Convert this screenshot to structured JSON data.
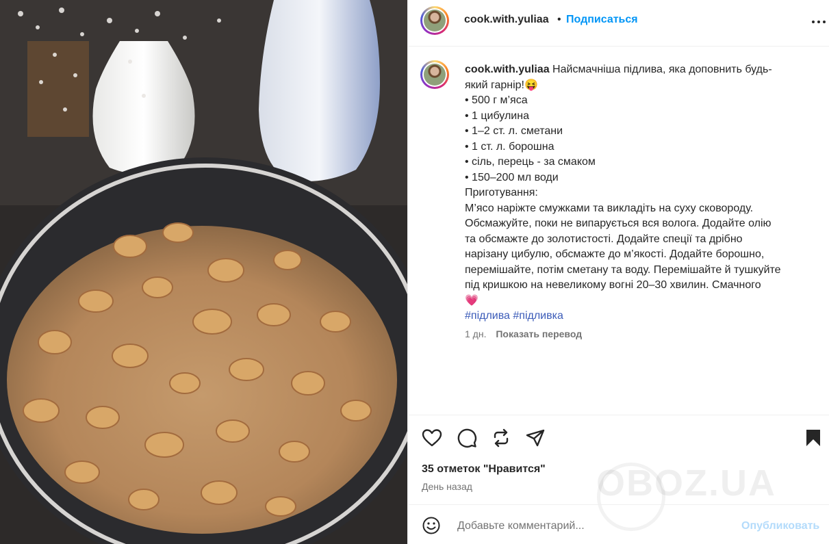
{
  "header": {
    "username": "cook.with.yuliaa",
    "separator": "•",
    "follow_label": "Подписаться",
    "more_label": "•••"
  },
  "caption": {
    "username": "cook.with.yuliaa",
    "intro": "Найсмачніша підлива, яка доповнить будь-",
    "intro_cont": "який гарнір!😝",
    "ingredients": [
      "• 500 г м’яса",
      "• 1 цибулина",
      "• 1–2 ст. л. сметани",
      "• 1 ст. л. борошна",
      "• сіль, перець - за смаком",
      "• 150–200 мл води"
    ],
    "method_title": "Приготування:",
    "method_lines": [
      "М’ясо наріжте смужками та викладіть на суху сковороду.",
      "Обсмажуйте, поки не випарується вся волога. Додайте олію",
      "та обсмажте до золотистості. Додайте спеції та дрібно",
      "нарізану цибулю, обсмажте до м’якості. Додайте борошно,",
      "перемішайте, потім сметану та воду. Перемішайте й тушкуйте",
      "під кришкою на невеликому вогні 20–30 хвилин. Смачного",
      "💗"
    ],
    "hashtags": "#підлива #підливка"
  },
  "meta": {
    "age": "1 дн.",
    "translate_label": "Показать перевод"
  },
  "stats": {
    "likes": "35 отметок \"Нравится\"",
    "posted": "День назад"
  },
  "comment": {
    "placeholder": "Добавьте комментарий...",
    "publish_label": "Опубликовать"
  },
  "watermark": "OBOZ.UA",
  "icons": [
    "smiley-icon",
    "heart-icon",
    "comment-icon",
    "repost-icon",
    "share-icon",
    "bookmark-icon",
    "more-icon"
  ],
  "colors": {
    "accent": "#0095f6",
    "hashtag": "#3b5bb8",
    "publish_disabled": "#b3dbfb",
    "muted": "#737373"
  }
}
